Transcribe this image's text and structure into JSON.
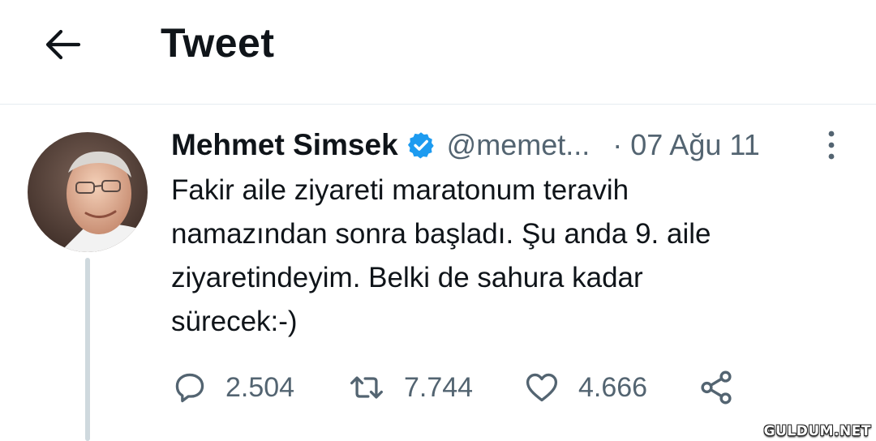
{
  "header": {
    "title": "Tweet",
    "back_icon": "arrow-left-icon"
  },
  "tweet": {
    "author": {
      "display_name": "Mehmet Simsek",
      "handle": "@memet...",
      "verified": true,
      "avatar_icon": "user-avatar"
    },
    "separator": "·",
    "date": "07 Ağu 11",
    "text": "Fakir aile ziyareti maratonum teravih\nnamazından sonra başladı. Şu anda 9. aile\nziyaretindeyim. Belki de sahura kadar\nsürecek:-)",
    "stats": {
      "replies": "2.504",
      "retweets": "7.744",
      "likes": "4.666"
    }
  },
  "colors": {
    "text": "#0f1419",
    "secondary": "#536471",
    "verified": "#1d9bf0",
    "divider": "#e6ecf0",
    "thread_line": "#cfd9de"
  },
  "watermark": "GULDUM.NET"
}
